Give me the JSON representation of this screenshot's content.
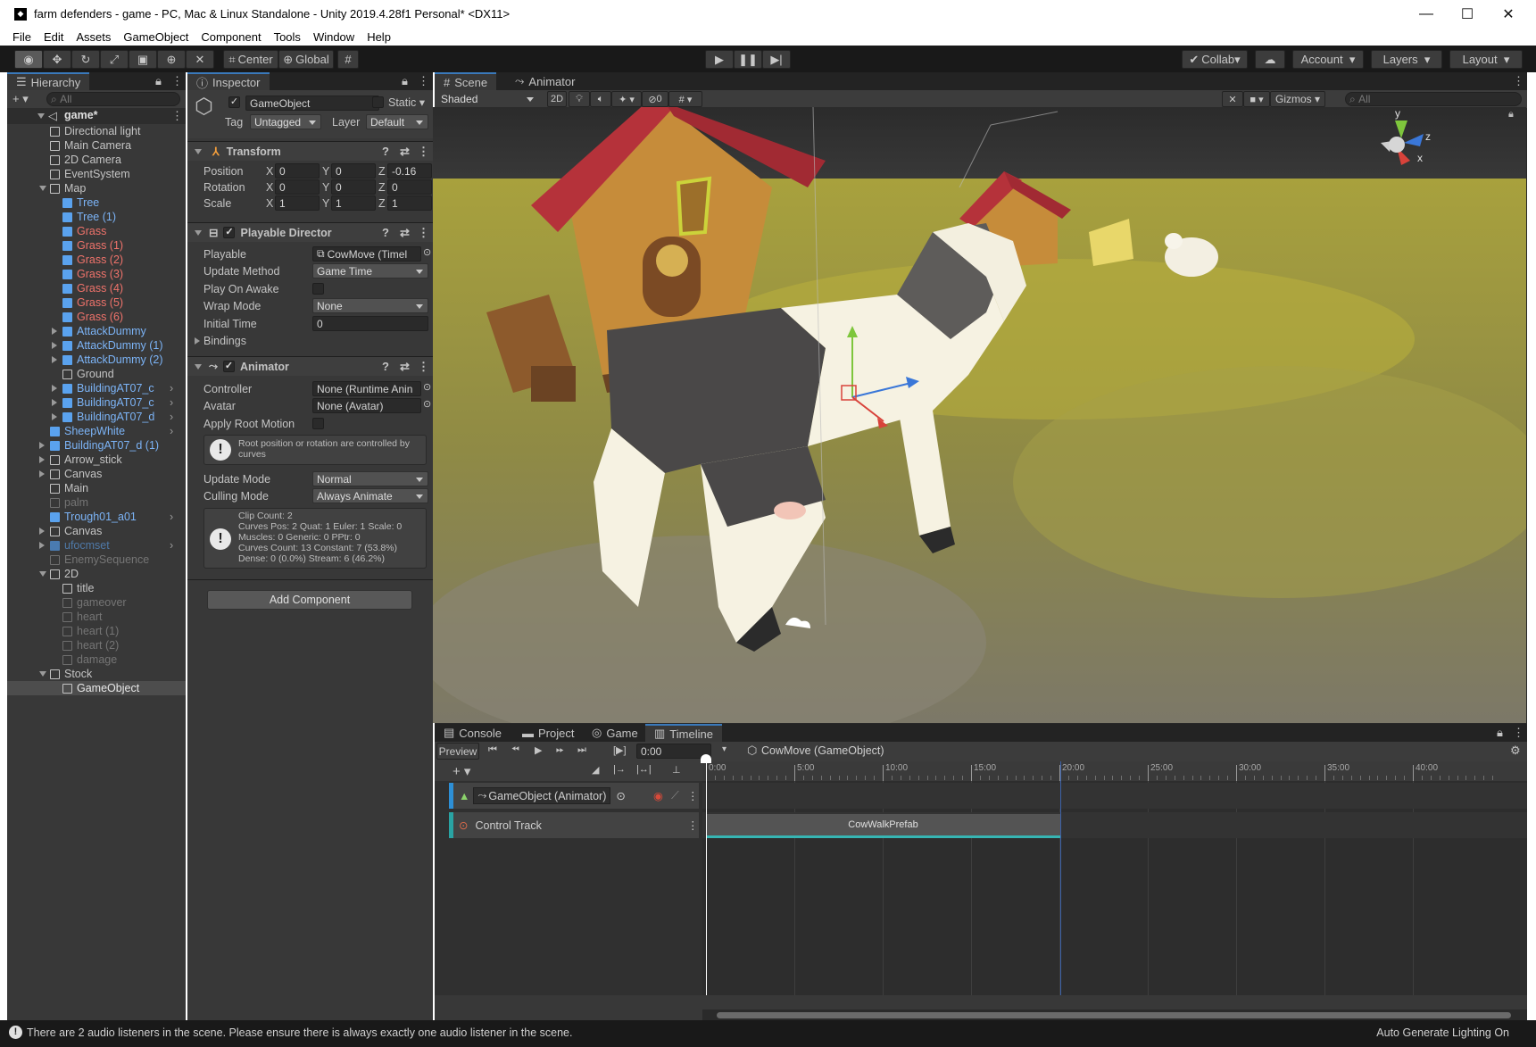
{
  "window": {
    "title": "farm defenders - game - PC, Mac & Linux Standalone - Unity 2019.4.28f1 Personal* <DX11>",
    "controls": [
      "—",
      "☐",
      "✕"
    ]
  },
  "menu": [
    "File",
    "Edit",
    "Assets",
    "GameObject",
    "Component",
    "Tools",
    "Window",
    "Help"
  ],
  "toolbar": {
    "pivot": "Center",
    "space": "Global",
    "collab": "Collab",
    "account": "Account",
    "layers": "Layers",
    "layout": "Layout"
  },
  "hierarchy": {
    "tab": "Hierarchy",
    "search_placeholder": "All",
    "scene": "game*",
    "items": [
      {
        "label": "Directional light",
        "style": "normal",
        "depth": 1
      },
      {
        "label": "Main Camera",
        "style": "normal",
        "depth": 1
      },
      {
        "label": "2D Camera",
        "style": "normal",
        "depth": 1
      },
      {
        "label": "EventSystem",
        "style": "normal",
        "depth": 1
      },
      {
        "label": "Map",
        "style": "normal",
        "depth": 1
      },
      {
        "label": "Tree",
        "style": "prefab",
        "depth": 2
      },
      {
        "label": "Tree (1)",
        "style": "prefab",
        "depth": 2
      },
      {
        "label": "Grass",
        "style": "missing",
        "depth": 2
      },
      {
        "label": "Grass (1)",
        "style": "missing",
        "depth": 2
      },
      {
        "label": "Grass (2)",
        "style": "missing",
        "depth": 2
      },
      {
        "label": "Grass (3)",
        "style": "missing",
        "depth": 2
      },
      {
        "label": "Grass (4)",
        "style": "missing",
        "depth": 2
      },
      {
        "label": "Grass (5)",
        "style": "missing",
        "depth": 2
      },
      {
        "label": "Grass (6)",
        "style": "missing",
        "depth": 2
      },
      {
        "label": "AttackDummy",
        "style": "prefab",
        "depth": 2
      },
      {
        "label": "AttackDummy (1)",
        "style": "prefab",
        "depth": 2
      },
      {
        "label": "AttackDummy (2)",
        "style": "prefab",
        "depth": 2
      },
      {
        "label": "Ground",
        "style": "normal",
        "depth": 2
      },
      {
        "label": "BuildingAT07_c",
        "style": "prefab",
        "depth": 2
      },
      {
        "label": "BuildingAT07_c",
        "style": "prefab",
        "depth": 2
      },
      {
        "label": "BuildingAT07_d",
        "style": "prefab",
        "depth": 2
      },
      {
        "label": "SheepWhite",
        "style": "prefab",
        "depth": 1
      },
      {
        "label": "BuildingAT07_d (1)",
        "style": "prefab",
        "depth": 1
      },
      {
        "label": "Arrow_stick",
        "style": "normal",
        "depth": 1
      },
      {
        "label": "Canvas",
        "style": "normal",
        "depth": 1
      },
      {
        "label": "Main",
        "style": "normal",
        "depth": 1
      },
      {
        "label": "palm",
        "style": "dim",
        "depth": 1
      },
      {
        "label": "Trough01_a01",
        "style": "prefab",
        "depth": 1
      },
      {
        "label": "Canvas",
        "style": "normal",
        "depth": 1
      },
      {
        "label": "ufocmset",
        "style": "dimprefab",
        "depth": 1
      },
      {
        "label": "EnemySequence",
        "style": "dim",
        "depth": 1
      },
      {
        "label": "2D",
        "style": "normal",
        "depth": 1
      },
      {
        "label": "title",
        "style": "normal",
        "depth": 2
      },
      {
        "label": "gameover",
        "style": "dim",
        "depth": 2
      },
      {
        "label": "heart",
        "style": "dim",
        "depth": 2
      },
      {
        "label": "heart (1)",
        "style": "dim",
        "depth": 2
      },
      {
        "label": "heart (2)",
        "style": "dim",
        "depth": 2
      },
      {
        "label": "damage",
        "style": "dim",
        "depth": 2
      },
      {
        "label": "Stock",
        "style": "normal",
        "depth": 1
      },
      {
        "label": "GameObject",
        "style": "selected",
        "depth": 2
      }
    ]
  },
  "inspector": {
    "tab": "Inspector",
    "object_name": "GameObject",
    "static_label": "Static",
    "tag_label": "Tag",
    "tag_value": "Untagged",
    "layer_label": "Layer",
    "layer_value": "Default",
    "transform": {
      "title": "Transform",
      "position_label": "Position",
      "rotation_label": "Rotation",
      "scale_label": "Scale",
      "axis_x": "X",
      "axis_y": "Y",
      "axis_z": "Z",
      "position": [
        "0",
        "0",
        "-0.16"
      ],
      "rotation": [
        "0",
        "0",
        "0"
      ],
      "scale": [
        "1",
        "1",
        "1"
      ]
    },
    "director": {
      "title": "Playable Director",
      "playable_label": "Playable",
      "playable_value": "CowMove (Timel",
      "update_method_label": "Update Method",
      "update_method_value": "Game Time",
      "play_on_awake_label": "Play On Awake",
      "wrap_mode_label": "Wrap Mode",
      "wrap_mode_value": "None",
      "initial_time_label": "Initial Time",
      "initial_time_value": "0",
      "bindings_label": "Bindings"
    },
    "animator": {
      "title": "Animator",
      "controller_label": "Controller",
      "controller_value": "None (Runtime Anin",
      "avatar_label": "Avatar",
      "avatar_value": "None (Avatar)",
      "apply_root_label": "Apply Root Motion",
      "root_note": "Root position or rotation are controlled by curves",
      "update_mode_label": "Update Mode",
      "update_mode_value": "Normal",
      "culling_label": "Culling Mode",
      "culling_value": "Always Animate",
      "stats": [
        "Clip Count: 2",
        "Curves Pos: 2 Quat: 1 Euler: 1 Scale: 0",
        "Muscles: 0 Generic: 0 PPtr: 0",
        "Curves Count: 13 Constant: 7 (53.8%)",
        "Dense: 0 (0.0%) Stream: 6 (46.2%)"
      ]
    },
    "add_component": "Add Component"
  },
  "scene": {
    "tabs": [
      "Scene",
      "Animator"
    ],
    "shading": "Shaded",
    "mode_2d": "2D",
    "hidden_count": "0",
    "gizmos": "Gizmos",
    "search_placeholder": "All",
    "axis_y": "y",
    "axis_z": "z",
    "axis_x": "x"
  },
  "bottom": {
    "tabs": [
      "Console",
      "Project",
      "Game",
      "Timeline"
    ],
    "preview": "Preview",
    "time": "0:00",
    "asset": "CowMove (GameObject)",
    "ruler": [
      "0:00",
      "5:00",
      "10:00",
      "15:00",
      "20:00",
      "25:00",
      "30:00",
      "35:00",
      "40:00"
    ],
    "tracks": [
      {
        "label": "GameObject (Animator)"
      },
      {
        "label": "Control Track"
      }
    ],
    "clip": "CowWalkPrefab"
  },
  "status": {
    "message": "There are 2 audio listeners in the scene. Please ensure there is always exactly one audio listener in the scene.",
    "right": "Auto Generate Lighting On"
  }
}
